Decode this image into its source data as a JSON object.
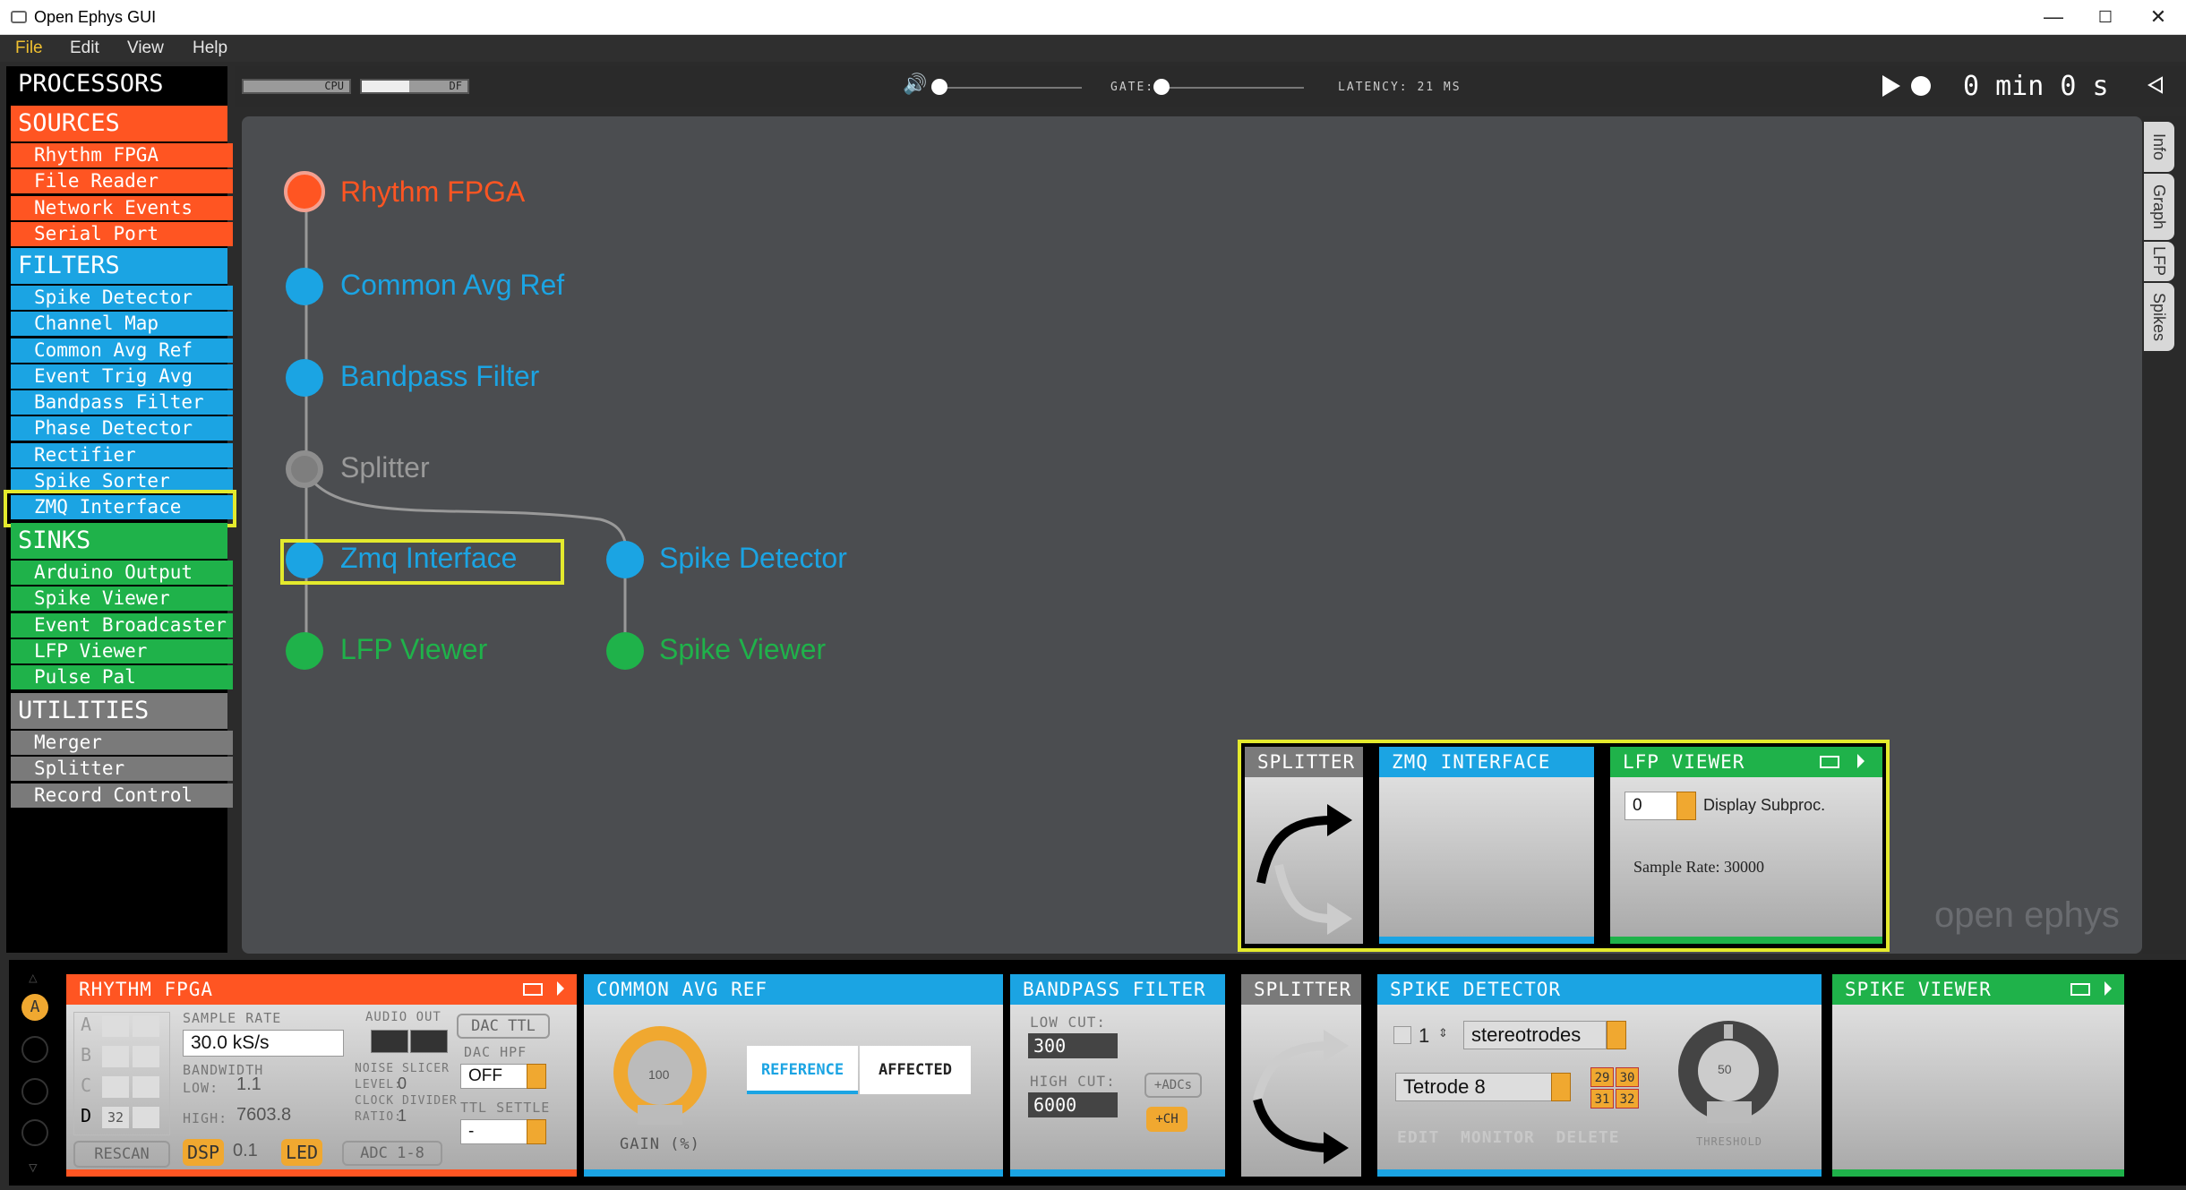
{
  "window": {
    "title": "Open Ephys GUI",
    "minimize": "—",
    "maximize": "☐",
    "close": "✕"
  },
  "menu": [
    "File",
    "Edit",
    "View",
    "Help"
  ],
  "sidebar": {
    "title": "PROCESSORS",
    "sources": {
      "label": "SOURCES",
      "items": [
        "Rhythm FPGA",
        "File Reader",
        "Network Events",
        "Serial Port"
      ]
    },
    "filters": {
      "label": "FILTERS",
      "items": [
        "Spike Detector",
        "Channel Map",
        "Common Avg Ref",
        "Event Trig Avg",
        "Bandpass Filter",
        "Phase Detector",
        "Rectifier",
        "Spike Sorter",
        "ZMQ Interface"
      ]
    },
    "sinks": {
      "label": "SINKS",
      "items": [
        "Arduino Output",
        "Spike Viewer",
        "Event Broadcaster",
        "LFP Viewer",
        "Pulse Pal"
      ]
    },
    "utilities": {
      "label": "UTILITIES",
      "items": [
        "Merger",
        "Splitter",
        "Record Control"
      ]
    }
  },
  "topbar": {
    "cpu_label": "CPU",
    "df_label": "DF",
    "gate_label": "GATE:",
    "latency": "LATENCY: 21 MS",
    "clock": "0 min 0 s",
    "volume_level": 0.0,
    "gate_level": 0.0
  },
  "tabs": [
    "Info",
    "Graph",
    "LFP",
    "Spikes"
  ],
  "graph": {
    "nodes": {
      "rhythm": "Rhythm FPGA",
      "car": "Common Avg Ref",
      "bandpass": "Bandpass Filter",
      "splitter": "Splitter",
      "zmq": "Zmq Interface",
      "spike_detector": "Spike Detector",
      "lfp": "LFP Viewer",
      "spike_viewer": "Spike Viewer"
    }
  },
  "popup": {
    "splitter": "SPLITTER",
    "zmq": "ZMQ INTERFACE",
    "lfp": {
      "title": "LFP VIEWER",
      "subproc": "0",
      "display": "Display Subproc.",
      "sample_rate": "Sample Rate: 30000"
    }
  },
  "watermark": "open ephys",
  "chain": {
    "rhythm": {
      "title": "RHYTHM FPGA",
      "ports": [
        "A",
        "B",
        "C",
        "D"
      ],
      "port_d_count": "32",
      "rescan": "RESCAN",
      "sample_rate_label": "SAMPLE RATE",
      "sample_rate": "30.0 kS/s",
      "bandwidth_label": "BANDWIDTH",
      "low_label": "LOW:",
      "low": "1.1",
      "high_label": "HIGH:",
      "high": "7603.8",
      "dsp": "DSP",
      "dsp_val": "0.1",
      "led": "LED",
      "audio_out": "AUDIO OUT",
      "noise_slicer": "NOISE SLICER",
      "level_label": "LEVEL:",
      "level": "0",
      "clock_divider": "CLOCK DIVIDER",
      "ratio_label": "RATIO:",
      "ratio": "1",
      "adc": "ADC 1-8",
      "dac_ttl": "DAC TTL",
      "dac_hpf": "DAC HPF",
      "dac_hpf_val": "OFF",
      "ttl_settle": "TTL SETTLE",
      "ttl_settle_val": "-"
    },
    "car": {
      "title": "COMMON AVG REF",
      "knob_value": "100",
      "gain_label": "GAIN (%)",
      "reference": "REFERENCE",
      "affected": "AFFECTED"
    },
    "bandpass": {
      "title": "BANDPASS FILTER",
      "low_label": "LOW CUT:",
      "low": "300",
      "high_label": "HIGH CUT:",
      "high": "6000",
      "adc_btn": "+ADCs",
      "ch_btn": "+CH"
    },
    "splitter": {
      "title": "SPLITTER"
    },
    "spike_detector": {
      "title": "SPIKE DETECTOR",
      "count": "1",
      "type": "stereotrodes",
      "electrode": "Tetrode 8",
      "channels": [
        "29",
        "30",
        "31",
        "32"
      ],
      "actions": "EDIT  MONITOR  DELETE",
      "threshold_value": "50",
      "threshold_label": "THRESHOLD"
    },
    "spike_viewer": {
      "title": "SPIKE VIEWER"
    },
    "nav": {
      "active": "A"
    }
  },
  "colors": {
    "source": "#ff5522",
    "filter": "#1ba4e3",
    "sink": "#1fb24a",
    "utility": "#7a7a7a",
    "highlight": "#e4ea2d",
    "graph_bg": "#4b4d50"
  }
}
